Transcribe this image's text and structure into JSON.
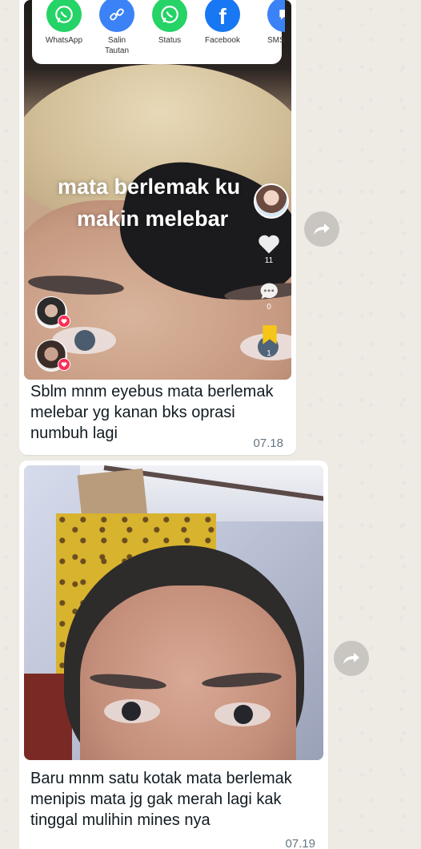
{
  "colors": {
    "chat_background": "#eeeae4",
    "bubble": "#ffffff",
    "caption_text": "#111b21",
    "timestamp": "#667781",
    "whatsapp_green": "#25d366",
    "link_blue": "#3b82f6",
    "facebook_blue": "#1877f2",
    "tiktok_red": "#fe2c55",
    "forward_button": "#c9c6c1"
  },
  "messages": [
    {
      "media_type": "video",
      "share_sheet": {
        "items": [
          {
            "label": "WhatsApp",
            "icon": "whatsapp-icon"
          },
          {
            "label": "Salin\nTautan",
            "icon": "link-icon"
          },
          {
            "label": "Status",
            "icon": "whatsapp-status-icon"
          },
          {
            "label": "Facebook",
            "icon": "facebook-icon"
          },
          {
            "label": "SMS",
            "icon": "sms-icon"
          }
        ]
      },
      "overlay_text": [
        "mata berlemak ku",
        "makin melebar"
      ],
      "side_rail": {
        "likes": "11",
        "comments": "0",
        "saves": "1"
      },
      "caption": "Sblm mnm eyebus mata berlemak melebar yg kanan bks oprasi  numbuh lagi",
      "time": "07.18"
    },
    {
      "media_type": "photo",
      "caption": "Baru mnm satu kotak mata berlemak menipis mata jg gak merah lagi kak tinggal mulihin mines nya",
      "time": "07.19"
    }
  ]
}
